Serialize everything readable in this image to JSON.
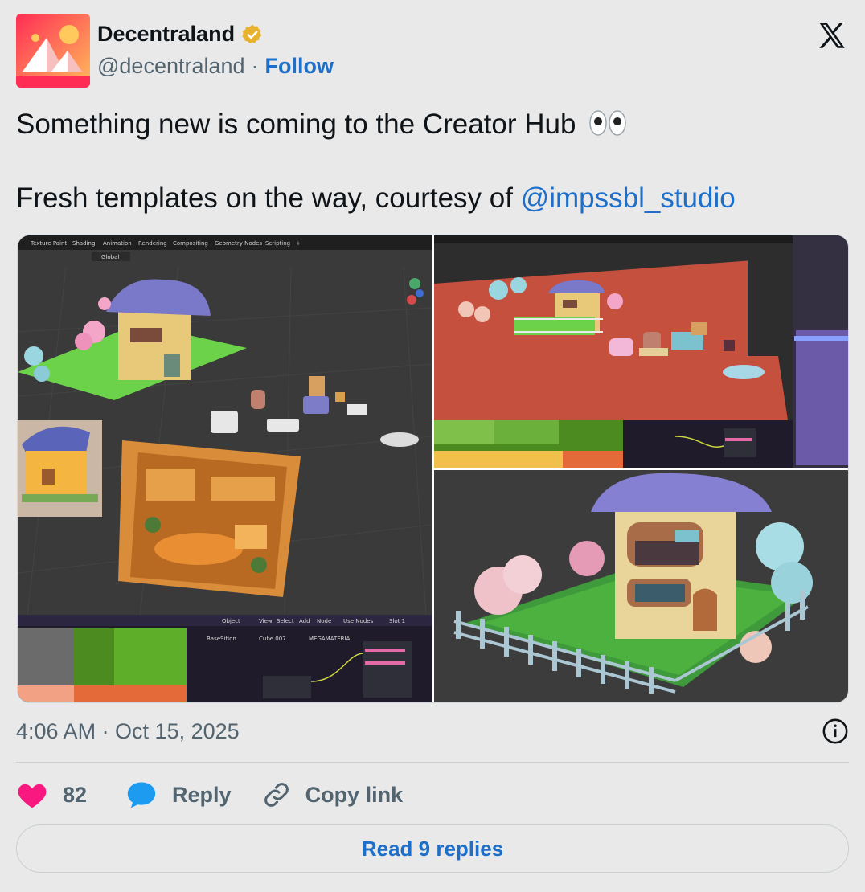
{
  "author": {
    "display_name": "Decentraland",
    "handle": "@decentraland",
    "separator": "·",
    "follow_label": "Follow"
  },
  "tweet": {
    "line1": "Something new is coming to the Creator Hub",
    "line2_prefix": "Fresh templates on the way, courtesy of ",
    "mention": "@impssbl_studio"
  },
  "media": {
    "left_tabs": [
      "Texture Paint",
      "Shading",
      "Animation",
      "Rendering",
      "Compositing",
      "Geometry Nodes",
      "Scripting",
      "+"
    ],
    "left_toolbar": [
      "Global",
      "Object",
      "View",
      "Select",
      "Add",
      "Node",
      "Use Nodes",
      "Slot 1"
    ],
    "left_node_labels": [
      "BaseSition",
      "Cube.007",
      "MEGAMATERIAL"
    ]
  },
  "meta": {
    "timestamp": "4:06 AM · Oct 15, 2025"
  },
  "actions": {
    "like_count": "82",
    "reply_label": "Reply",
    "copy_label": "Copy link"
  },
  "footer": {
    "read_replies_label": "Read 9 replies"
  },
  "colors": {
    "accent": "#1d6fc9",
    "like": "#f91880",
    "muted": "#536471"
  }
}
